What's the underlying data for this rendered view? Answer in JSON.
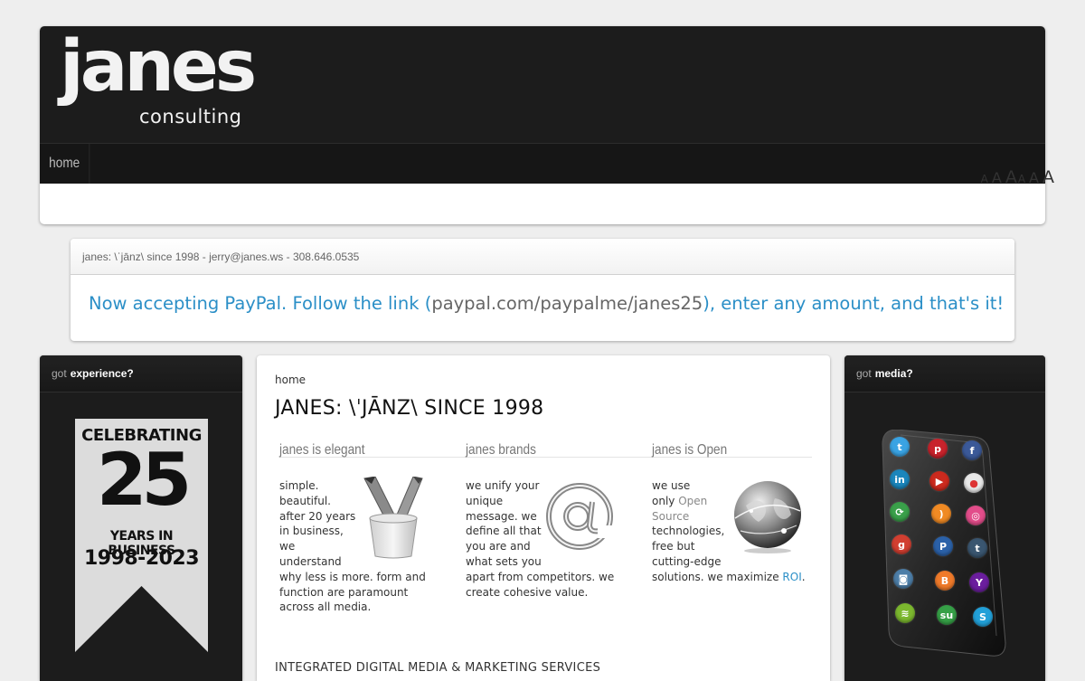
{
  "header": {
    "logo_main": "janes",
    "logo_sub": "consulting",
    "nav": [
      {
        "label": "home"
      }
    ],
    "font_sizes": [
      "A",
      "A",
      "A",
      "A",
      "A",
      "A"
    ]
  },
  "info": {
    "contact": "janes: \\ˈjānz\\ since 1998 - jerry@janes.ws - 308.646.0535",
    "message_before": "Now accepting PayPal. Follow the link (",
    "message_link": "paypal.com/paypalme/janes25",
    "message_after": "), enter any amount, and that's it!"
  },
  "left_panel": {
    "heading_pre": "got",
    "heading_strong": "experience?",
    "banner": {
      "line1": "CELEBRATING",
      "number": "25",
      "line2": "YEARS IN BUSINESS",
      "line3": "1998-2023"
    },
    "colors": {
      "banner_bg": "#dcdcdc"
    }
  },
  "right_panel": {
    "heading_pre": "got",
    "heading_strong": "media?",
    "apps": [
      {
        "icon": "twitter-icon",
        "glyph": "t",
        "color": "#3aa3e3"
      },
      {
        "icon": "pinterest-icon",
        "glyph": "p",
        "color": "#c8232c"
      },
      {
        "icon": "facebook-icon",
        "glyph": "f",
        "color": "#3b5998"
      },
      {
        "icon": "linkedin-icon",
        "glyph": "in",
        "color": "#1b86bc"
      },
      {
        "icon": "youtube-icon",
        "glyph": "▶",
        "color": "#cc2a1e"
      },
      {
        "icon": "flickr-icon",
        "glyph": "●",
        "color": "#e8e8e8"
      },
      {
        "icon": "share-icon",
        "glyph": "⟳",
        "color": "#3aa04a"
      },
      {
        "icon": "rss-icon",
        "glyph": ")",
        "color": "#f08a24"
      },
      {
        "icon": "dribbble-icon",
        "glyph": "◎",
        "color": "#e24d8a"
      },
      {
        "icon": "google-plus-icon",
        "glyph": "g",
        "color": "#d23f31"
      },
      {
        "icon": "paypal-icon",
        "glyph": "P",
        "color": "#2b61a8"
      },
      {
        "icon": "tumblr-icon",
        "glyph": "t",
        "color": "#3a5670"
      },
      {
        "icon": "instagram-icon",
        "glyph": "◙",
        "color": "#4d7ea8"
      },
      {
        "icon": "blogger-icon",
        "glyph": "B",
        "color": "#ef7a2a"
      },
      {
        "icon": "yahoo-icon",
        "glyph": "Y",
        "color": "#6b1e9e"
      },
      {
        "icon": "spotify-icon",
        "glyph": "≋",
        "color": "#7cb82f"
      },
      {
        "icon": "stumbleupon-icon",
        "glyph": "su",
        "color": "#36a047"
      },
      {
        "icon": "skype-icon",
        "glyph": "S",
        "color": "#22a0d8"
      }
    ]
  },
  "main": {
    "breadcrumb": "home",
    "title": "JANES: \\ˈJĀNZ\\ SINCE 1998",
    "columns": [
      {
        "title": "janes is elegant",
        "icon": "pencil-cup-icon",
        "lines": [
          "simple.",
          "beautiful.",
          "after 20 years",
          "in business,",
          "we",
          "understand",
          "why less is more. form and",
          "function are paramount",
          "across all media."
        ]
      },
      {
        "title": "janes brands",
        "icon": "at-sign-icon",
        "lines": [
          "we unify your",
          "unique",
          "message. we",
          "define all that",
          "you are and",
          "what sets you",
          "apart from competitors. we",
          "create cohesive value."
        ]
      },
      {
        "title": "janes is Open",
        "icon": "globe-icon",
        "lines_before": [
          "we use"
        ],
        "only_text": "only ",
        "open_link": "Open",
        "source_link": "Source",
        "lines_after": [
          "technologies,",
          "free but",
          "cutting-edge"
        ],
        "last_line_text": "solutions. we maximize ",
        "roi_link": "ROI",
        "last_line_end": "."
      }
    ],
    "services_heading": "INTEGRATED DIGITAL MEDIA & MARKETING SERVICES"
  }
}
